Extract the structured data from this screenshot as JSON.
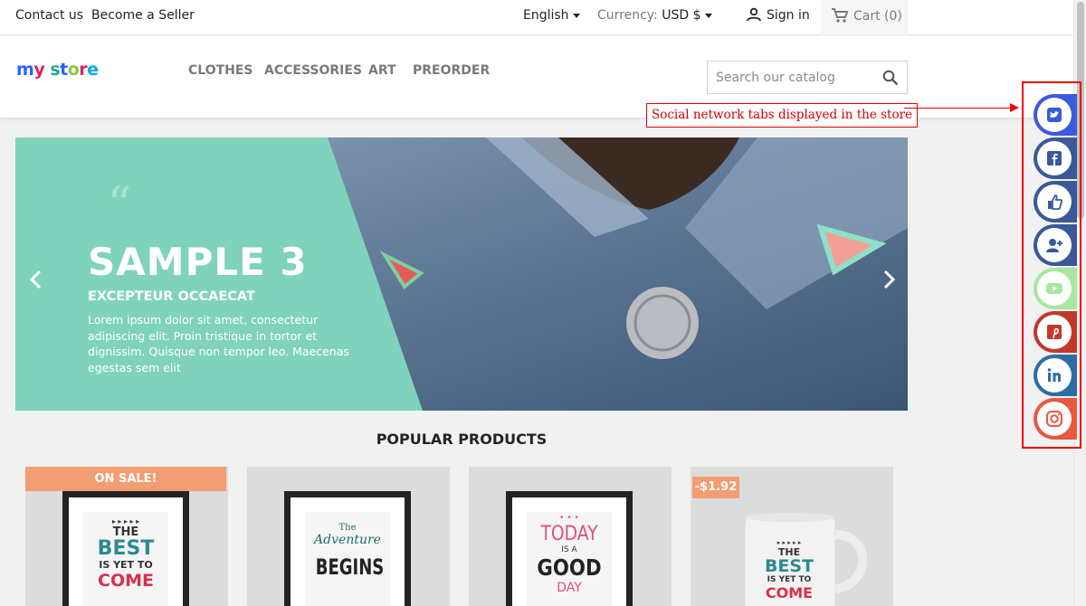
{
  "topbar": {
    "contact": "Contact us",
    "seller": "Become a Seller",
    "language": "English",
    "currency_label": "Currency:",
    "currency_value": "USD $",
    "signin": "Sign in",
    "cart": "Cart (0)"
  },
  "header": {
    "logo": [
      "m",
      "y",
      " ",
      "s",
      "t",
      "o",
      "r",
      "e"
    ],
    "menu": [
      "CLOTHES",
      "ACCESSORIES",
      "ART",
      "PREORDER"
    ],
    "search_placeholder": "Search our catalog"
  },
  "annotation": "Social network tabs displayed in the store",
  "social": [
    {
      "name": "twitter",
      "color": "#3b5bdb"
    },
    {
      "name": "facebook",
      "color": "#3b5998"
    },
    {
      "name": "like",
      "color": "#3b5998"
    },
    {
      "name": "follow",
      "color": "#3b5998"
    },
    {
      "name": "youtube",
      "color": "#a8e6a3"
    },
    {
      "name": "pinterest",
      "color": "#c0392b"
    },
    {
      "name": "linkedin",
      "color": "#2e6da4"
    },
    {
      "name": "instagram",
      "color": "#e9573f"
    }
  ],
  "slide": {
    "quote": "“",
    "title": "SAMPLE 3",
    "subtitle": "EXCEPTEUR OCCAECAT",
    "text": "Lorem ipsum dolor sit amet, consectetur adipiscing elit. Proin tristique in tortor et dignissim. Quisque non tempor leo. Maecenas egestas sem elit",
    "panel_color": "#7fd3bc"
  },
  "products": {
    "title": "POPULAR PRODUCTS",
    "items": [
      {
        "badge": "ON SALE!",
        "lines": [
          "▸ ▸ ▸ ▸ ▸",
          "THE",
          "BEST",
          "IS YET TO",
          "COME"
        ]
      },
      {
        "badge": "",
        "lines": [
          "The",
          "Adventure",
          "BEGINS"
        ]
      },
      {
        "badge": "",
        "lines": [
          "• • •",
          "TODAY",
          "IS A",
          "GOOD",
          "DAY"
        ]
      },
      {
        "badge": "-$1.92",
        "lines": [
          "▸ ▸ ▸ ▸ ▸",
          "THE",
          "BEST",
          "IS YET TO",
          "COME"
        ]
      }
    ]
  }
}
